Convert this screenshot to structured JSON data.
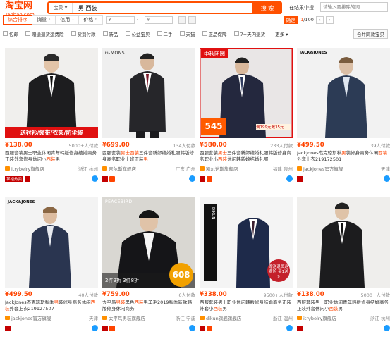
{
  "header": {
    "logo": "淘宝网",
    "logo_sub": "Taobao.com",
    "search_type": "宝贝",
    "search_query": "男 西装",
    "search_button": "搜 索",
    "in_result_label": "在结果中搜",
    "in_result_placeholder": "请输入要排除的词"
  },
  "sortbar": {
    "items": [
      "综合排序",
      "销量",
      "信用",
      "价格"
    ],
    "price_from": "¥",
    "price_to": "¥",
    "confirm": "确定",
    "page_current": "1",
    "page_total": "/100"
  },
  "filters": {
    "items": [
      "包邮",
      "赠送退货运费险",
      "货到付款",
      "新品",
      "公益宝贝",
      "二手",
      "天猫",
      "正品保障",
      "7+天内退货"
    ],
    "more": "更多",
    "merge": "合并同款宝贝"
  },
  "products": [
    {
      "price": "¥138.00",
      "sold": "5000+人付款",
      "title_pre": "西服套装男士职业休闲青年韩版修身结婚商务正装外套修身休闲小",
      "title_hl": "西装",
      "title_post": "男",
      "shop": "itrybelry旗舰店",
      "loc": "浙江 杭州",
      "img_banner": "送衬衫/领带/衣架/防尘袋",
      "badges": [
        "掌柜热卖"
      ]
    },
    {
      "price": "¥699.00",
      "sold": "134人付款",
      "title_pre": "西服套装",
      "title_hl": "男士西装",
      "title_post": "三件套新郎结婚礼服韩版修身商务职业上班正装",
      "title_hl2": "男",
      "shop": "吉尔斯旗舰店",
      "loc": "广东 广州",
      "img_brand": "G-MONS"
    },
    {
      "price": "¥580.00",
      "sold": "233人付款",
      "title_pre": "西服套装",
      "title_hl": "男士",
      "title_post": "三件套新郎结婚礼服韩版修身商务职业小",
      "title_hl2": "西装",
      "title_post2": "休闲韩新娘结婚礼服",
      "shop": "凯尔达斯旗舰店",
      "loc": "福建 泉州",
      "img_tag": "中秋团圆",
      "img_price": "545",
      "img_note": "满199元减35元"
    },
    {
      "price": "¥499.50",
      "sold": "39人付款",
      "title_pre": "JackJones杰克琼斯秋",
      "title_hl": "男",
      "title_post": "装修身商务休闲",
      "title_hl2": "西装",
      "title_post2": "外套上衣219172501",
      "shop": "jackjones官方旗舰",
      "loc": "天津",
      "img_brand": "JACK&JONES"
    },
    {
      "price": "¥499.50",
      "sold": "40人付款",
      "title_pre": "JackJones杰克琼斯秋季",
      "title_hl": "男",
      "title_post": "装修身商务休闲",
      "title_hl2": "西装",
      "title_post2": "外套上衣219127507",
      "shop": "jackjones官方旗舰",
      "loc": "天津",
      "img_brand": "JACK&JONES"
    },
    {
      "price": "¥759.00",
      "sold": "6人付款",
      "title_pre": "太平鸟",
      "title_hl": "男装",
      "title_post": "黑色",
      "title_hl2": "西装",
      "title_post2": "男羊毛2019秋季新款韩版修身休闲商务",
      "shop": "太平鸟男装旗舰店",
      "loc": "浙江 宁波",
      "img_brand": "PEACEBIRD",
      "img_promo": "2件9折 3件8折",
      "img_price": "608"
    },
    {
      "price": "¥338.00",
      "sold": "9500+人付款",
      "title_pre": "西服套装男士职业休闲韩版修身结婚商务正装外套小",
      "title_hl": "西装",
      "title_post": "男",
      "shop": "dikun旗舰旗舰店",
      "loc": "浙江 温州",
      "img_brand": "DIKUN",
      "img_promo": "赠送退货运费险 买1送9"
    },
    {
      "price": "¥138.00",
      "sold": "5000+人付款",
      "title_pre": "西服套装男士职业休闲青年韩版修身结婚商务正装外套休闲小",
      "title_hl": "西装",
      "title_post": "男",
      "shop": "itrybelry旗舰店",
      "loc": "浙江 杭州"
    }
  ]
}
